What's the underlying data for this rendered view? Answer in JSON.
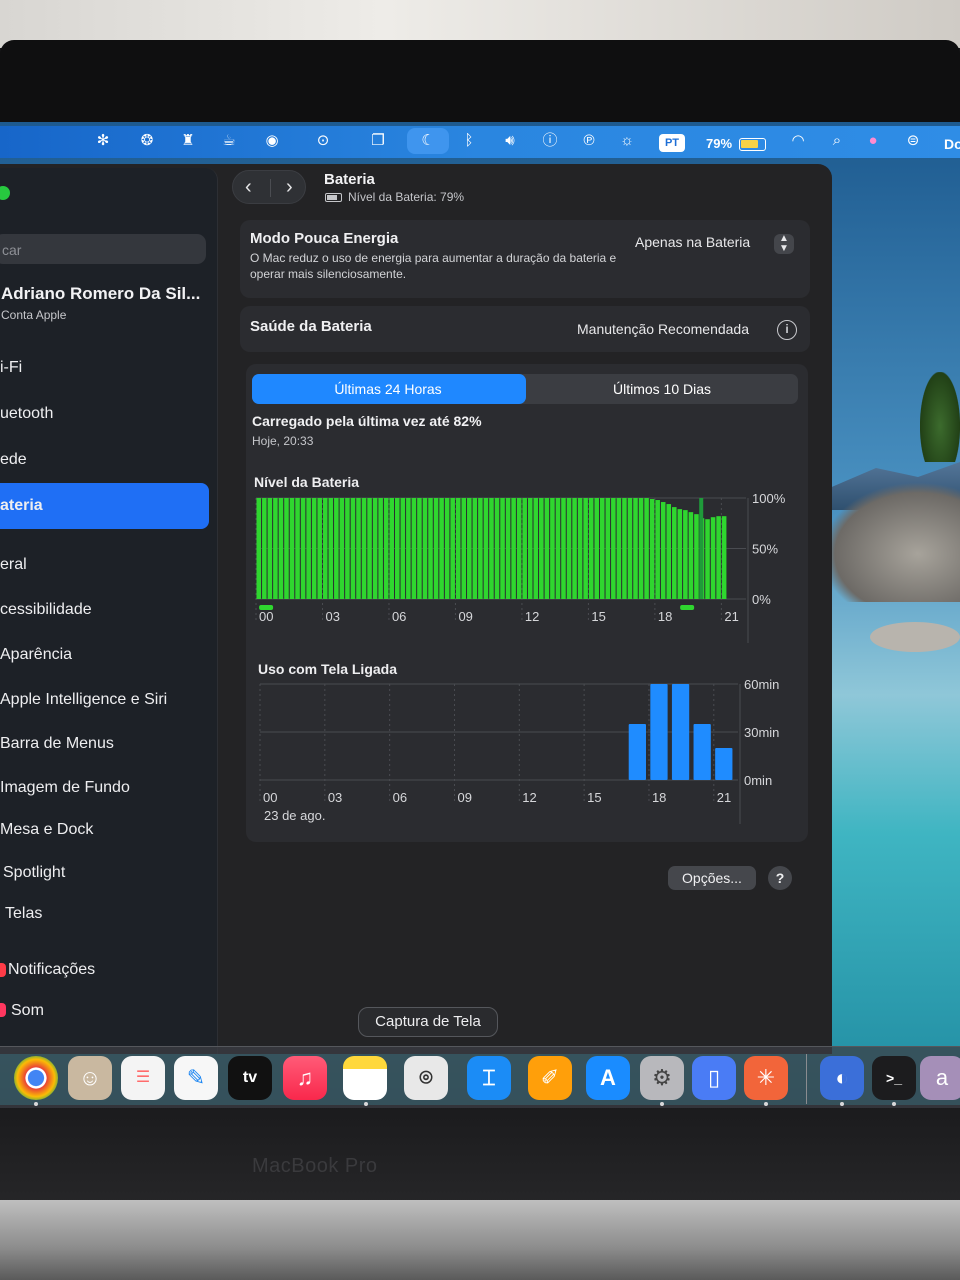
{
  "menubar": {
    "language_badge": "PT",
    "battery_percent": "79%",
    "battery_level": 0.79,
    "clock_partial": "Do",
    "accent": "#2a86e0"
  },
  "sidebar": {
    "search_placeholder": "car",
    "account": {
      "name": "Adriano Romero Da Sil...",
      "subtitle": "Conta Apple"
    },
    "items": [
      {
        "label": "i-Fi",
        "icon": "wifi-icon"
      },
      {
        "label": "uetooth",
        "icon": "bluetooth-icon"
      },
      {
        "label": "ede",
        "icon": "network-icon"
      },
      {
        "label": "ateria",
        "icon": "battery-icon",
        "selected": true
      },
      {
        "label": "eral",
        "icon": "gear-icon"
      },
      {
        "label": "cessibilidade",
        "icon": "accessibility-icon"
      },
      {
        "label": "Aparência",
        "icon": "appearance-icon"
      },
      {
        "label": "Apple Intelligence e Siri",
        "icon": "siri-icon"
      },
      {
        "label": "Barra de Menus",
        "icon": "menubar-icon"
      },
      {
        "label": "Imagem de Fundo",
        "icon": "wallpaper-icon"
      },
      {
        "label": "Mesa e Dock",
        "icon": "dock-icon"
      },
      {
        "label": "Spotlight",
        "icon": "spotlight-icon"
      },
      {
        "label": "Telas",
        "icon": "displays-icon"
      },
      {
        "label": "Notificações",
        "icon": "notifications-icon"
      },
      {
        "label": "Som",
        "icon": "sound-icon"
      }
    ]
  },
  "header": {
    "title": "Bateria",
    "subtitle": "Nível da Bateria: 79%"
  },
  "low_power": {
    "title": "Modo Pouca Energia",
    "description": "O Mac reduz o uso de energia para aumentar a duração da bateria e operar mais silenciosamente.",
    "value": "Apenas na Bateria"
  },
  "health": {
    "label": "Saúde da Bateria",
    "value": "Manutenção Recomendada"
  },
  "tabs": [
    {
      "label": "Últimas 24 Horas",
      "active": true
    },
    {
      "label": "Últimos 10 Dias",
      "active": false
    }
  ],
  "last_charge": {
    "text": "Carregado pela última vez até 82%",
    "time": "Hoje, 20:33"
  },
  "buttons": {
    "options": "Opções...",
    "help": "?"
  },
  "tooltip": "Captura de Tela",
  "dock": {
    "apps": [
      "chrome-icon",
      "contacts-icon",
      "reminders-icon",
      "freeform-icon",
      "appletv-icon",
      "music-icon",
      "notes-icon",
      "screenshot-icon",
      "keynote-icon",
      "pages-icon",
      "appstore-icon",
      "system-settings-icon",
      "simulator-icon",
      "claude-icon",
      "finder-icon",
      "terminal-icon",
      "app-a-icon"
    ],
    "appletv_label": "tv",
    "app_a_label": "a"
  },
  "device_label": "MacBook Pro",
  "chart_data": [
    {
      "type": "bar",
      "title": "Nível da Bateria",
      "x_ticks": [
        "00",
        "03",
        "06",
        "09",
        "12",
        "15",
        "18",
        "21"
      ],
      "y_ticks": [
        "100%",
        "50%",
        "0%"
      ],
      "ylim": [
        0,
        100
      ],
      "color": "#2fd62f",
      "x_hours": [
        0,
        0.25,
        0.5,
        0.75,
        1,
        1.25,
        1.5,
        1.75,
        2,
        2.25,
        2.5,
        2.75,
        3,
        3.25,
        3.5,
        3.75,
        4,
        4.25,
        4.5,
        4.75,
        5,
        5.25,
        5.5,
        5.75,
        6,
        6.25,
        6.5,
        6.75,
        7,
        7.25,
        7.5,
        7.75,
        8,
        8.25,
        8.5,
        8.75,
        9,
        9.25,
        9.5,
        9.75,
        10,
        10.25,
        10.5,
        10.75,
        11,
        11.25,
        11.5,
        11.75,
        12,
        12.25,
        12.5,
        12.75,
        13,
        13.25,
        13.5,
        13.75,
        14,
        14.25,
        14.5,
        14.75,
        15,
        15.25,
        15.5,
        15.75,
        16,
        16.25,
        16.5,
        16.75,
        17,
        17.25,
        17.5,
        17.75,
        18,
        18.25,
        18.5,
        18.75,
        19,
        19.25,
        19.5,
        19.75,
        20,
        20.25,
        20.5,
        20.75,
        21
      ],
      "values": [
        100,
        100,
        100,
        100,
        100,
        100,
        100,
        100,
        100,
        100,
        100,
        100,
        100,
        100,
        100,
        100,
        100,
        100,
        100,
        100,
        100,
        100,
        100,
        100,
        100,
        100,
        100,
        100,
        100,
        100,
        100,
        100,
        100,
        100,
        100,
        100,
        100,
        100,
        100,
        100,
        100,
        100,
        100,
        100,
        100,
        100,
        100,
        100,
        100,
        100,
        100,
        100,
        100,
        100,
        100,
        100,
        100,
        100,
        100,
        100,
        100,
        100,
        100,
        100,
        100,
        100,
        100,
        100,
        100,
        100,
        100,
        99,
        98,
        96,
        94,
        91,
        89,
        88,
        86,
        84,
        80,
        79,
        81,
        82,
        82
      ],
      "charging_markers_hours": [
        0.5,
        19.5
      ],
      "charge_spike_hour": 20.0
    },
    {
      "type": "bar",
      "title": "Uso com Tela Ligada",
      "x_ticks": [
        "00",
        "03",
        "06",
        "09",
        "12",
        "15",
        "18",
        "21"
      ],
      "y_ticks": [
        "60min",
        "30min",
        "0min"
      ],
      "ylim": [
        0,
        60
      ],
      "color": "#1f8cff",
      "x_hours": [
        17,
        18,
        19,
        20,
        21
      ],
      "values": [
        35,
        60,
        60,
        35,
        20
      ],
      "date_label": "23 de ago."
    }
  ]
}
